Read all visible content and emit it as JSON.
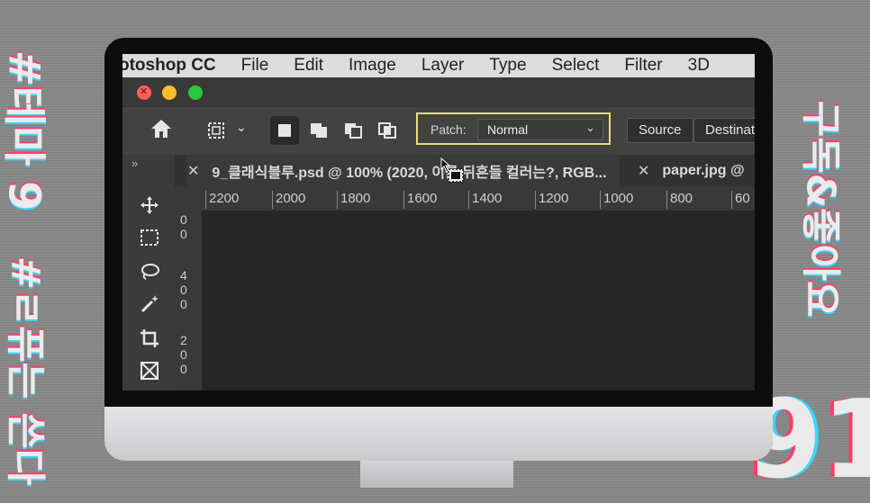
{
  "decor": {
    "left_text_1": "#테마 9",
    "left_text_2": "#ㄹ퓨는 쓴다",
    "right_text": "구독&좋아요",
    "big_number": "91"
  },
  "menubar": {
    "app_name": "otoshop CC",
    "items": [
      "File",
      "Edit",
      "Image",
      "Layer",
      "Type",
      "Select",
      "Filter",
      "3D"
    ]
  },
  "options": {
    "home_icon": "home-icon",
    "patch_label": "Patch:",
    "patch_value": "Normal",
    "source_button": "Source",
    "destination_button": "Destinat"
  },
  "tabs": [
    {
      "close": "✕",
      "label": "9_클래식블루.psd @ 100% (2020, 이를 뒤흔들 컬러는?, RGB..."
    },
    {
      "close": "✕",
      "label": "paper.jpg @"
    }
  ],
  "ruler": {
    "top_ticks": [
      "2200",
      "2000",
      "1800",
      "1600",
      "1400",
      "1200",
      "1000",
      "800",
      "60"
    ],
    "left_ticks": [
      "0\n0",
      "4\n0\n0",
      "2\n0\n0"
    ]
  },
  "tools": [
    "move-tool-icon",
    "marquee-tool-icon",
    "lasso-tool-icon",
    "magic-wand-icon",
    "crop-tool-icon",
    "frame-tool-icon"
  ],
  "colors": {
    "highlight": "#e5e36b",
    "close": "#fe5f57",
    "minimize": "#febc2e",
    "maximize": "#28c840"
  }
}
